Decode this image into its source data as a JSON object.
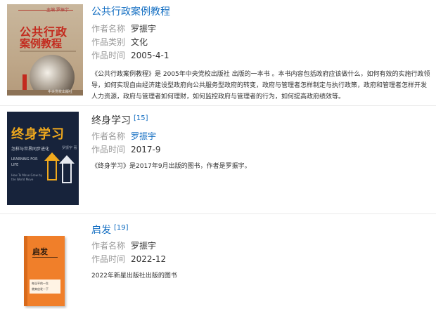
{
  "entries": [
    {
      "title": "公共行政案例教程",
      "ref": "",
      "fields": [
        {
          "label": "作者名称",
          "value": "罗振宇",
          "link": false
        },
        {
          "label": "作品类别",
          "value": "文化",
          "link": false
        },
        {
          "label": "作品时间",
          "value": "2005-4-1",
          "link": false
        }
      ],
      "description": "《公共行政案例教程》是 2005年中央党校出版社 出版的一本书 。本书内容包括政府应该做什么，如何有效的实施行政领导，如何实现自由经济建设型政府向公共服务型政府的转变，政府与管理者怎样制定与执行政策，政府和管理者怎样开发人力资源，政府与管理者如何理财，如何监控政府与管理者的行为，如何提高政府绩效等。",
      "cover": {
        "line_small": "主编 罗振宇",
        "line1": "公共行政",
        "line2": "案例教程",
        "publisher": "中央党校出版社"
      }
    },
    {
      "title": "终身学习",
      "ref": "[15]",
      "fields": [
        {
          "label": "作者名称",
          "value": "罗振宇",
          "link": true
        },
        {
          "label": "作品时间",
          "value": "2017-9",
          "link": false
        }
      ],
      "description": "《终身学习》是2017年9月出版的图书，作者是罗振宇。",
      "cover": {
        "line1": "终身学习",
        "subtitle": "怎样与世界同步进化",
        "author": "罗振宇 著",
        "en1": "LEARNING FOR LIFE",
        "en2": "How To Move Grow by the World Move"
      }
    },
    {
      "title": "启发",
      "ref": "[19]",
      "fields": [
        {
          "label": "作者名称",
          "value": "罗振宇",
          "link": false
        },
        {
          "label": "作品时间",
          "value": "2022-12",
          "link": false
        }
      ],
      "description": "2022年新星出版社出版的图书",
      "cover": {
        "line1": "启发",
        "box1": "每当平的一生",
        "box2": "就来启发一下"
      }
    }
  ]
}
